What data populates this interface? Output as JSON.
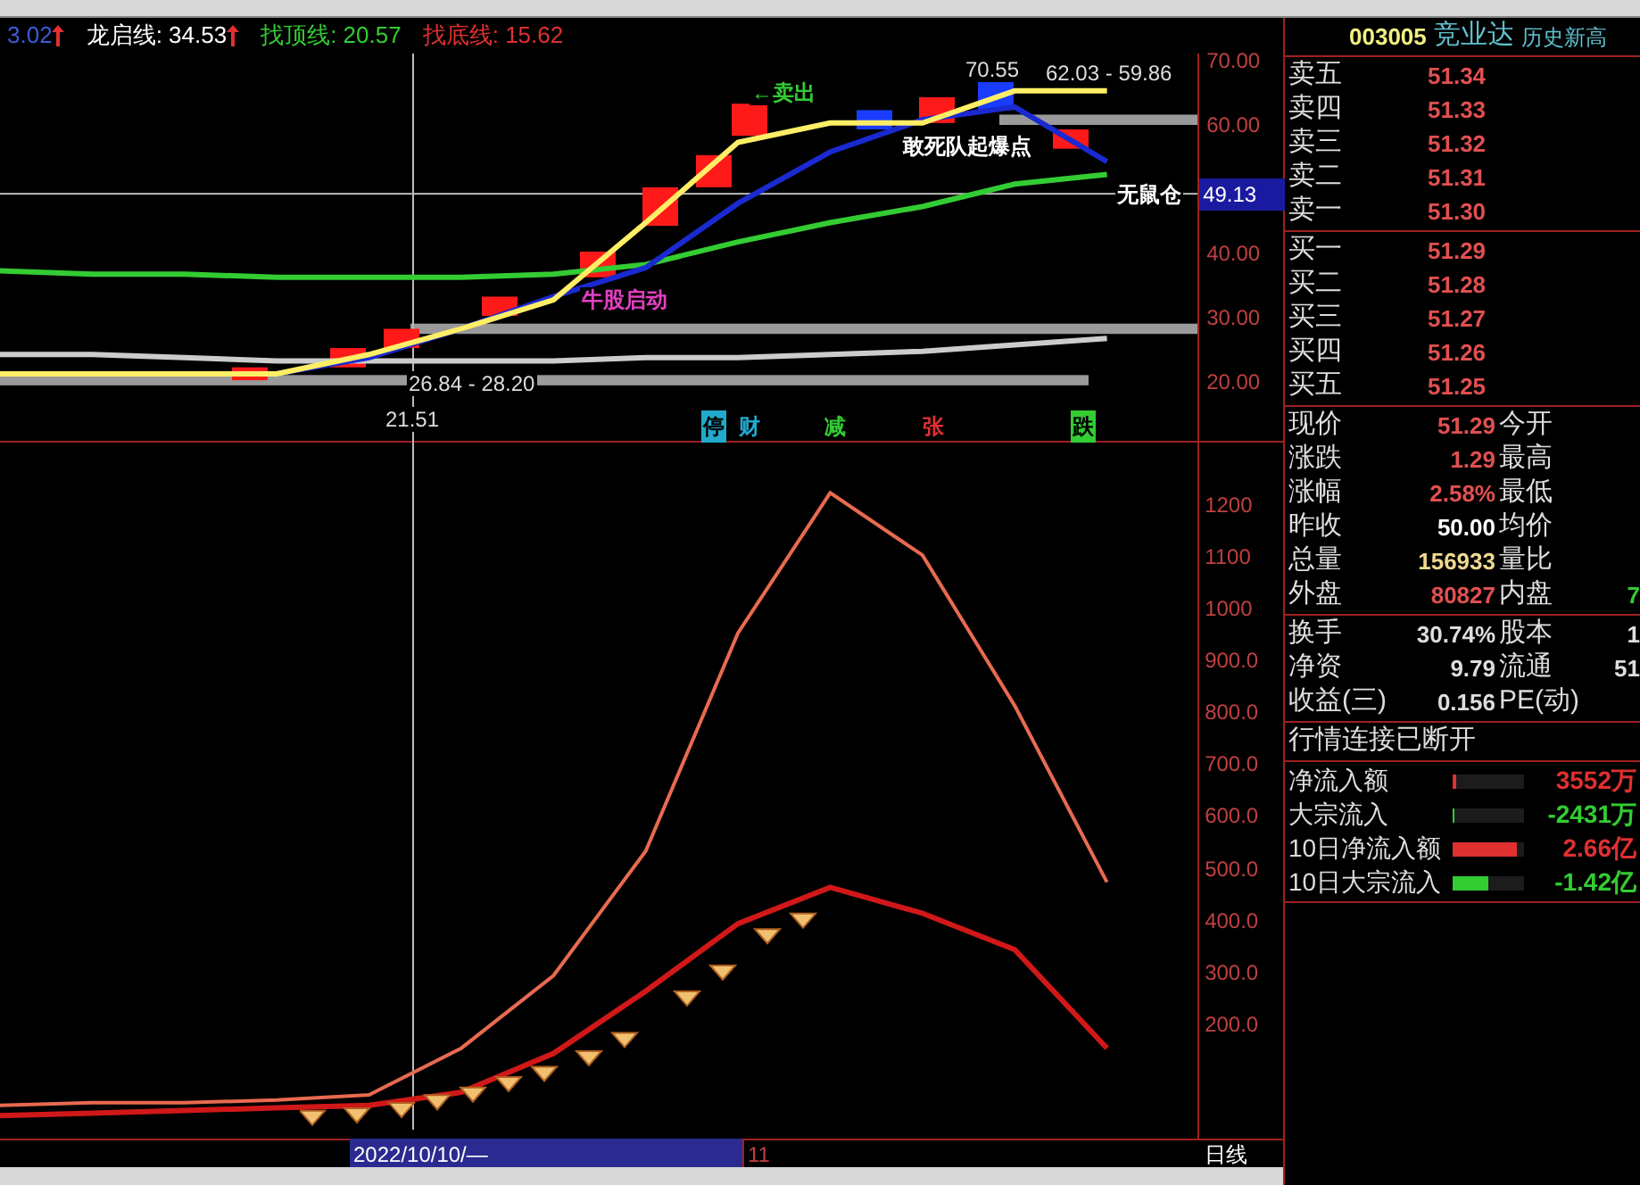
{
  "indicator_header": [
    {
      "label": "3.02",
      "color": "#3b5bd6",
      "arrow": true
    },
    {
      "label": "龙启线: 34.53",
      "color": "#ffffff",
      "arrow": true
    },
    {
      "label": "找顶线: 20.57",
      "color": "#33cc33",
      "arrow": false
    },
    {
      "label": "找底线: 15.62",
      "color": "#e03030",
      "arrow": false
    }
  ],
  "price_panel": {
    "chart_data": {
      "type": "line",
      "ylim": [
        10.3,
        70.8
      ],
      "ref_lines": [
        {
          "axis": "y",
          "value": 49.13,
          "label": "49.13"
        }
      ],
      "bands": [
        {
          "axis": "y",
          "from": 19.2,
          "to": 20.8
        },
        {
          "axis": "y",
          "from": 27.2,
          "to": 28.8
        },
        {
          "axis": "y",
          "from": 59.7,
          "to": 61.3
        }
      ],
      "categories": [
        null,
        null,
        null,
        null,
        null,
        null,
        null,
        null,
        null,
        null,
        null,
        null,
        null,
        null
      ],
      "yticks": [
        {
          "value": 70,
          "label": "70.00"
        },
        {
          "value": 60,
          "label": "60.00"
        },
        {
          "value": 40,
          "label": "40.00"
        },
        {
          "value": 30,
          "label": "30.00"
        },
        {
          "value": 20,
          "label": "20.00"
        }
      ],
      "series": [
        {
          "color": "#cccccc",
          "values": [
            24,
            24,
            23.5,
            23,
            23,
            23,
            23,
            23.5,
            23.5,
            24,
            24.5,
            25.5,
            26.5,
            null
          ]
        },
        {
          "color": "#33cc33",
          "values": [
            37,
            36.5,
            36.5,
            36,
            36,
            36,
            36.5,
            38,
            41.5,
            44.5,
            47,
            50.5,
            52,
            null
          ]
        },
        {
          "color": "#1a2ad0",
          "values": [
            null,
            null,
            null,
            21,
            23.5,
            28,
            33,
            37.5,
            47.5,
            55.5,
            60.5,
            62.5,
            54,
            null
          ]
        },
        {
          "color": "#ffee66",
          "values": [
            21,
            21,
            21,
            21,
            24,
            28,
            32.5,
            44.5,
            57,
            60,
            60,
            65,
            65,
            null
          ]
        }
      ]
    },
    "annotations": [
      {
        "kind": "signal",
        "text": "←卖出",
        "color": "#33cc33"
      },
      {
        "kind": "price",
        "text": "70.55",
        "color": "#dddddd"
      },
      {
        "kind": "price",
        "text": "62.03 - 59.86",
        "color": "#dddddd"
      },
      {
        "kind": "signal",
        "text": "敢死队起爆点",
        "color": "#ffffff"
      },
      {
        "kind": "signal",
        "text": "无鼠仓",
        "color": "#ffffff"
      },
      {
        "kind": "signal",
        "text": "牛股启动",
        "color": "#e040c0"
      },
      {
        "kind": "price",
        "text": "26.84 - 28.20",
        "color": "#dddddd"
      },
      {
        "kind": "price",
        "text": "21.51",
        "color": "#dddddd"
      }
    ],
    "markers": [
      {
        "text": "停",
        "color": "#22aacc",
        "filled": true
      },
      {
        "text": "财",
        "color": "#22aacc",
        "filled": false
      },
      {
        "text": "减",
        "color": "#33cc33",
        "filled": false
      },
      {
        "text": "张",
        "color": "#e03030",
        "filled": false
      },
      {
        "text": "跌",
        "color": "#33cc33",
        "filled": true
      }
    ]
  },
  "indicator_panel": {
    "chart_data": {
      "type": "line",
      "ylim": [
        -7,
        1317
      ],
      "categories": [
        null,
        null,
        null,
        null,
        null,
        null,
        null,
        null,
        null,
        null,
        null,
        null,
        null,
        null
      ],
      "yticks": [
        {
          "value": 1200,
          "label": "1200"
        },
        {
          "value": 1100,
          "label": "1100"
        },
        {
          "value": 1000,
          "label": "1000"
        },
        {
          "value": 900,
          "label": "900.0"
        },
        {
          "value": 800,
          "label": "800.0"
        },
        {
          "value": 700,
          "label": "700.0"
        },
        {
          "value": 600,
          "label": "600.0"
        },
        {
          "value": 500,
          "label": "500.0"
        },
        {
          "value": 400,
          "label": "400.0"
        },
        {
          "value": 300,
          "label": "300.0"
        },
        {
          "value": 200,
          "label": "200.0"
        }
      ],
      "series": [
        {
          "color": "#e86a50",
          "values": [
            40,
            45,
            45,
            50,
            60,
            150,
            290,
            530,
            950,
            1220,
            1100,
            810,
            470,
            null
          ]
        },
        {
          "color": "#d01818",
          "values": [
            20,
            25,
            30,
            35,
            40,
            65,
            140,
            260,
            390,
            460,
            410,
            340,
            150,
            null
          ]
        }
      ]
    }
  },
  "date_bar": {
    "cursor_date": "2022/10/10/—",
    "month": "11",
    "period": "日线"
  },
  "quote": {
    "code": "003005",
    "name": "竞业达",
    "badge": "历史新高",
    "asks": [
      {
        "label": "卖五",
        "price": "51.34"
      },
      {
        "label": "卖四",
        "price": "51.33"
      },
      {
        "label": "卖三",
        "price": "51.32"
      },
      {
        "label": "卖二",
        "price": "51.31"
      },
      {
        "label": "卖一",
        "price": "51.30"
      }
    ],
    "bids": [
      {
        "label": "买一",
        "price": "51.29"
      },
      {
        "label": "买二",
        "price": "51.28"
      },
      {
        "label": "买三",
        "price": "51.27"
      },
      {
        "label": "买四",
        "price": "51.26"
      },
      {
        "label": "买五",
        "price": "51.25"
      }
    ],
    "stats": [
      {
        "label": "现价",
        "value": "51.29",
        "color": "#e05050",
        "label_2": "今开"
      },
      {
        "label": "涨跌",
        "value": "1.29",
        "color": "#e05050",
        "label_2": "最高"
      },
      {
        "label": "涨幅",
        "value": "2.58%",
        "color": "#e05050",
        "label_2": "最低"
      },
      {
        "label": "昨收",
        "value": "50.00",
        "color": "#ffffff",
        "label_2": "均价"
      },
      {
        "label": "总量",
        "value": "156933",
        "color": "#f0d890",
        "label_2": "量比"
      },
      {
        "label": "外盘",
        "value": "80827",
        "color": "#e05050",
        "label_2": "内盘",
        "value_2": "7"
      }
    ],
    "fundamentals": [
      {
        "label": "换手",
        "value": "30.74%",
        "label_2": "股本",
        "value_2": "1"
      },
      {
        "label": "净资",
        "value": "9.79",
        "label_2": "流通",
        "value_2": "51"
      },
      {
        "label": "收益(三)",
        "value": "0.156",
        "label_2": "PE(动)"
      }
    ],
    "status": "行情连接已断开",
    "flows": [
      {
        "label": "净流入额",
        "level": 0.05,
        "color": "#e03030",
        "value": "3552万"
      },
      {
        "label": "大宗流入",
        "level": 0.03,
        "color": "#33cc33",
        "value": "-2431万"
      },
      {
        "label": "10日净流入额",
        "level": 0.9,
        "color": "#e03030",
        "value": "2.66亿"
      },
      {
        "label": "10日大宗流入",
        "level": 0.5,
        "color": "#33cc33",
        "value": "-1.42亿"
      }
    ]
  }
}
